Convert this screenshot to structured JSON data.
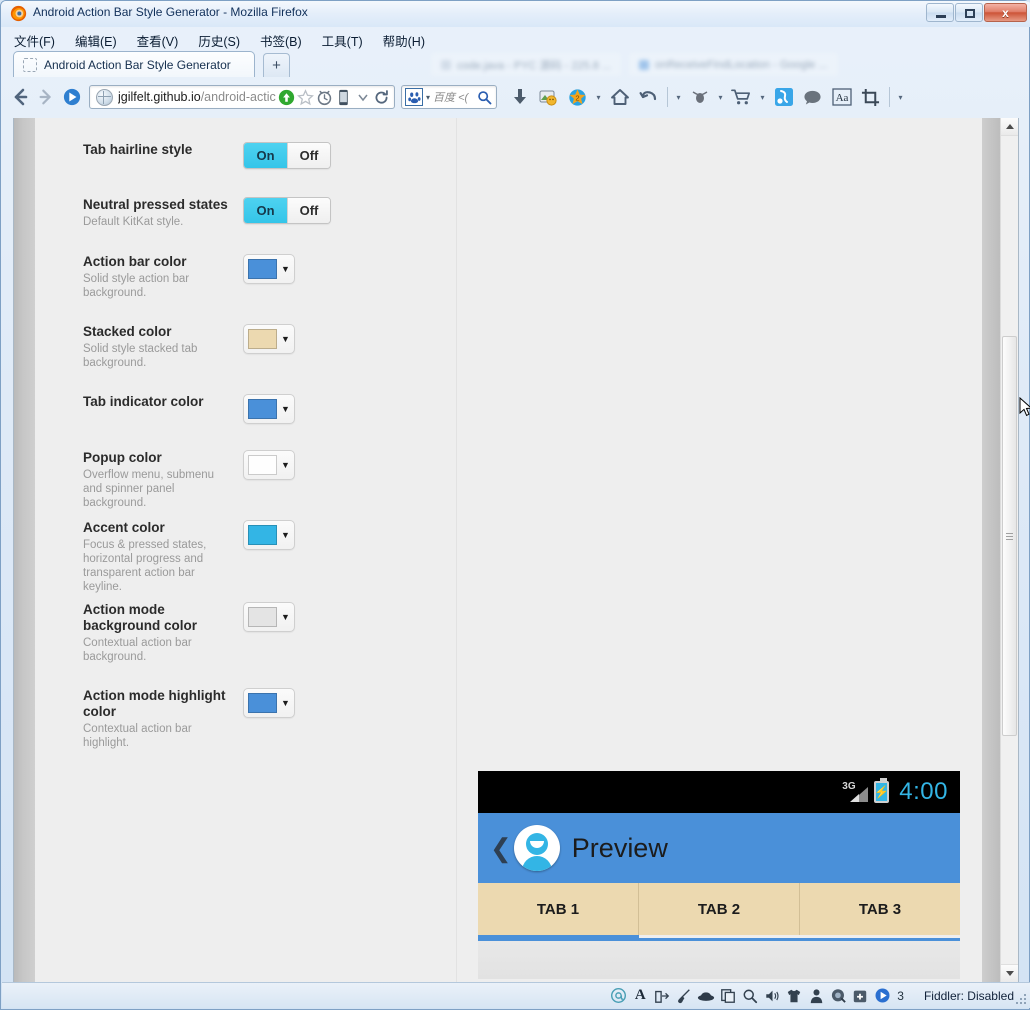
{
  "window": {
    "title": "Android Action Bar Style Generator - Mozilla Firefox",
    "icon": "firefox-icon",
    "minimize_label": "",
    "maximize_label": "",
    "close_label": "x"
  },
  "menubar": {
    "items": [
      {
        "label": "文件(F)",
        "name": "menu-file"
      },
      {
        "label": "编辑(E)",
        "name": "menu-edit"
      },
      {
        "label": "查看(V)",
        "name": "menu-view"
      },
      {
        "label": "历史(S)",
        "name": "menu-history"
      },
      {
        "label": "书签(B)",
        "name": "menu-bookmarks"
      },
      {
        "label": "工具(T)",
        "name": "menu-tools"
      },
      {
        "label": "帮助(H)",
        "name": "menu-help"
      }
    ]
  },
  "tabstrip": {
    "active_tab": "Android Action Bar Style Generator",
    "new_tab_label": "+",
    "background_tabs": [
      "code.java - PYC 源码 - 225.8 ...",
      "onReceiveFindLocation - Google ..."
    ]
  },
  "navbar": {
    "back_icon": "back-arrow-icon",
    "forward_icon": "forward-arrow-icon",
    "reader_icon": "reader-mode-icon",
    "url_domain": "jgilfelt.github.io",
    "url_path": "/android-actic",
    "go_icon": "go-arrow-icon",
    "bookmark_icon": "star-icon",
    "history_icon": "clock-icon",
    "mobile_icon": "mobile-device-icon",
    "dropdown_icon": "chevron-down-icon",
    "reload_icon": "reload-icon",
    "search_engine": "baidu-icon",
    "search_placeholder": "百度 <(",
    "search_icon": "magnifier-icon",
    "toolbar_icons": [
      "download-icon",
      "screenshot-icon",
      "security-shield-icon",
      "chevron-down-icon",
      "home-icon",
      "undo-icon",
      "chevron-down-icon",
      "mouse-gesture-icon",
      "chevron-down-icon",
      "shopping-cart-icon",
      "chevron-down-icon",
      "fiddler-icon",
      "comment-icon",
      "font-aa-icon",
      "crop-icon",
      "chevron-down-icon"
    ]
  },
  "generator": {
    "rows": [
      {
        "name": "tab-hairline-style",
        "label": "Tab hairline style",
        "sub": "",
        "control": "toggle",
        "on_label": "On",
        "off_label": "Off",
        "value": "On"
      },
      {
        "name": "neutral-pressed-states",
        "label": "Neutral pressed states",
        "sub": "Default KitKat style.",
        "control": "toggle",
        "on_label": "On",
        "off_label": "Off",
        "value": "On"
      },
      {
        "name": "action-bar-color",
        "label": "Action bar color",
        "sub": "Solid style action bar background.",
        "control": "color",
        "color": "#4a90d9"
      },
      {
        "name": "stacked-color",
        "label": "Stacked color",
        "sub": "Solid style stacked tab background.",
        "control": "color",
        "color": "#ecd9b0"
      },
      {
        "name": "tab-indicator-color",
        "label": "Tab indicator color",
        "sub": "",
        "control": "color",
        "color": "#4a90d9"
      },
      {
        "name": "popup-color",
        "label": "Popup color",
        "sub": "Overflow menu, submenu and spinner panel background.",
        "control": "color",
        "color": "#fefefe"
      },
      {
        "name": "accent-color",
        "label": "Accent color",
        "sub": "Focus & pressed states, horizontal progress and transparent action bar keyline.",
        "control": "color",
        "color": "#33b5e5"
      },
      {
        "name": "action-mode-background-color",
        "label": "Action mode background color",
        "sub": "Contextual action bar background.",
        "control": "color",
        "color": "#e4e4e4"
      },
      {
        "name": "action-mode-highlight-color",
        "label": "Action mode highlight color",
        "sub": "Contextual action bar highlight.",
        "control": "color",
        "color": "#4a90d9"
      }
    ]
  },
  "preview": {
    "status_bar": {
      "network": "3G",
      "signal_icon": "signal-bars-icon",
      "battery_icon": "battery-charging-icon",
      "clock": "4:00",
      "background": "#000000",
      "accent": "#33b5e5"
    },
    "action_bar": {
      "back_icon": "back-chevron-icon",
      "avatar_icon": "user-avatar-icon",
      "title": "Preview",
      "background": "#4a90d9"
    },
    "tabs": [
      {
        "label": "TAB 1",
        "selected": true
      },
      {
        "label": "TAB 2",
        "selected": false
      },
      {
        "label": "TAB 3",
        "selected": false
      }
    ],
    "tab_background": "#ecd9b0",
    "indicator_color": "#4a90d9"
  },
  "statusbar": {
    "icons": [
      "at-sign-icon",
      "font-a-icon",
      "export-icon",
      "brush-icon",
      "hat-icon",
      "copy-icon",
      "magnifier-icon",
      "speaker-icon",
      "shirt-icon",
      "person-icon",
      "mouse-icon",
      "firstaid-icon",
      "play-icon"
    ],
    "count": "3",
    "fiddler_status": "Fiddler: Disabled"
  },
  "scrollbar": {
    "up_arrow": "triangle-up-icon",
    "down_arrow": "triangle-down-icon",
    "thumb": "scroll-thumb"
  }
}
